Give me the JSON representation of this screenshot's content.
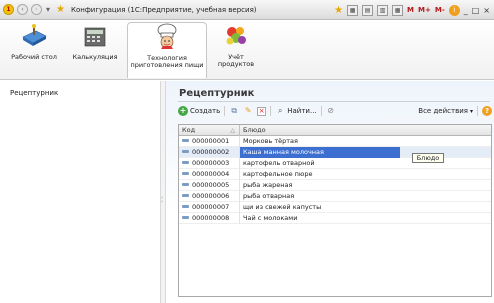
{
  "titlebar": {
    "title": "Конфигурация  (1С:Предприятие, учебная версия)",
    "right_labels": [
      "M",
      "M+",
      "M-"
    ]
  },
  "sections": [
    {
      "label": "Рабочий стол",
      "icon": "desktop-icon"
    },
    {
      "label": "Калькуляция",
      "icon": "calculator-icon"
    },
    {
      "label": "Технология приготовления пищи",
      "icon": "chef-icon"
    },
    {
      "label": "Учёт продуктов",
      "icon": "products-icon"
    }
  ],
  "leftnav": {
    "items": [
      "Рецептурник"
    ]
  },
  "form": {
    "title": "Рецептурник",
    "create_label": "Создать",
    "find_label": "Найти...",
    "all_actions_label": "Все действия",
    "help_label": "?"
  },
  "table": {
    "columns": [
      "Код",
      "Блюдо"
    ],
    "rows": [
      {
        "code": "000000001",
        "dish": "Морковь тёртая"
      },
      {
        "code": "000000002",
        "dish": "Каша манная молочная"
      },
      {
        "code": "000000003",
        "dish": "картофель отварной"
      },
      {
        "code": "000000004",
        "dish": "картофельное пюре"
      },
      {
        "code": "000000005",
        "dish": "рыба жареная"
      },
      {
        "code": "000000006",
        "dish": "рыба отварная"
      },
      {
        "code": "000000007",
        "dish": "щи из свежей капусты"
      },
      {
        "code": "000000008",
        "dish": "Чай с молоками"
      }
    ],
    "selected_row": 1,
    "tooltip": "Блюдо"
  },
  "colors": {
    "selection": "#3d6fd1",
    "accent": "#f0a020"
  }
}
